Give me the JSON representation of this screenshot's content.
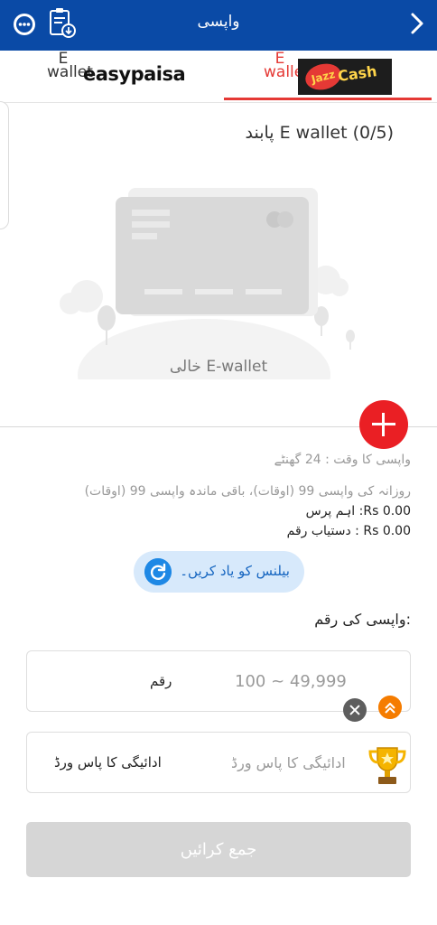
{
  "header": {
    "title": "واپسی",
    "chat_icon": "chat-support-icon",
    "doc_icon": "clipboard-history-icon",
    "back_icon": "chevron-right-icon"
  },
  "tabs": [
    {
      "label": "E wallet",
      "logo_text": "easypaisa",
      "active": false
    },
    {
      "label": "E wallet",
      "logo_text_1": "Jazz",
      "logo_text_2": "Cash",
      "active": true
    }
  ],
  "wallet": {
    "heading": "پابند E wallet (0/5)",
    "empty_text": "خالی E-wallet"
  },
  "info": {
    "withdraw_time": "واپسی کا وقت  :  24 گھنٹے",
    "daily_limit": "روزانہ کی واپسی 99 (اوقات)، باقی ماندہ واپسی 99 (اوقات)",
    "purse": "اہم پرس :Rs 0.00",
    "available": "دستیاب رقم : Rs 0.00"
  },
  "reminder": {
    "label": "بیلنس کو یاد کریں۔"
  },
  "amount": {
    "title": "واپسی کی رقم:",
    "label": "رقم",
    "placeholder": "100 ~ 49,999"
  },
  "password": {
    "label": "ادائیگی کا پاس ورڈ",
    "placeholder": "ادائیگی کا پاس ورڈ"
  },
  "submit": {
    "label": "جمع کرائیں"
  },
  "colors": {
    "header": "#0a4aa6",
    "accent_red": "#ea1f24",
    "reminder_bg": "#d7e9fb",
    "disabled_button": "#d6d6d6"
  }
}
